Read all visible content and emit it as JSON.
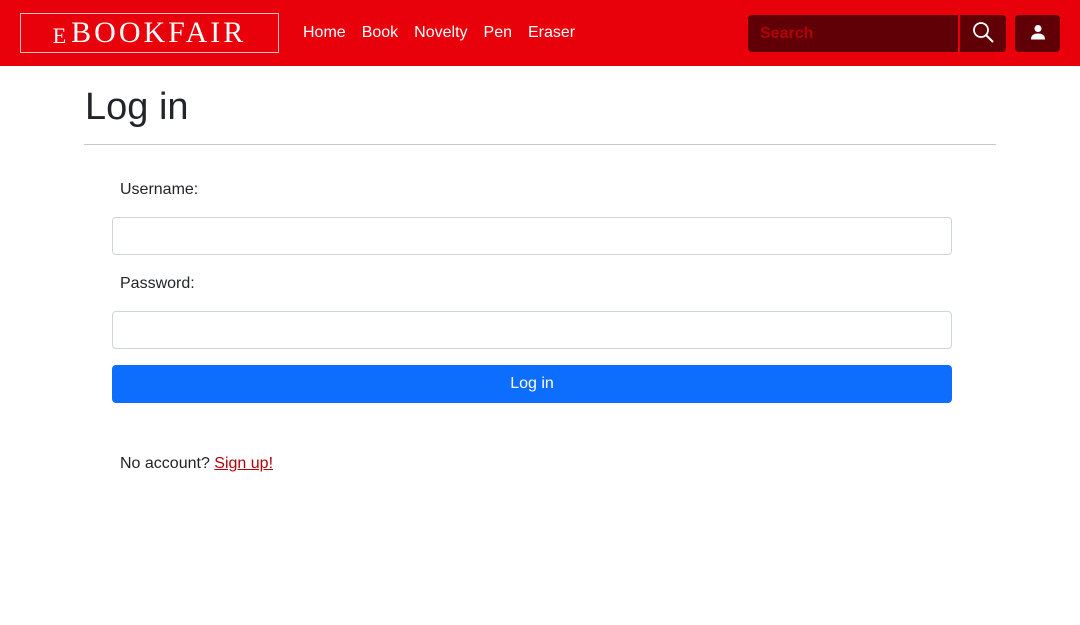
{
  "brand": {
    "small": "E",
    "big": "BOOKFAIR"
  },
  "nav": {
    "links": [
      {
        "label": "Home"
      },
      {
        "label": "Book"
      },
      {
        "label": "Novelty"
      },
      {
        "label": "Pen"
      },
      {
        "label": "Eraser"
      }
    ],
    "search_placeholder": "Search",
    "search_icon": "search-icon",
    "user_icon": "user-icon"
  },
  "page": {
    "title": "Log in"
  },
  "form": {
    "username_label": "Username:",
    "username_value": "",
    "password_label": "Password:",
    "password_value": "",
    "submit_label": "Log in"
  },
  "signup": {
    "prompt": "No account?",
    "link_label": "Sign up!"
  },
  "colors": {
    "navbar": "#e8000b",
    "navbar_dark": "#600006",
    "primary_button": "#0d6efd",
    "link": "#b0000a"
  }
}
